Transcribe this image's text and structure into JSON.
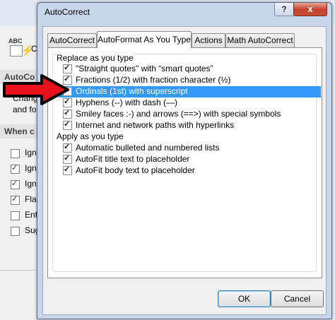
{
  "background_dialog": {
    "icon_text": "ABC",
    "section1_title": "AutoCo",
    "section1_text": [
      "Chang",
      "and fo"
    ],
    "section2_title": "When c",
    "checks": [
      {
        "label": "Ign",
        "checked": false
      },
      {
        "label": "Ign",
        "checked": true
      },
      {
        "label": "Ign",
        "checked": true
      },
      {
        "label": "Fla",
        "checked": true
      },
      {
        "label": "Enf",
        "checked": false
      },
      {
        "label": "Sug",
        "checked": false
      }
    ],
    "window_letter": "C"
  },
  "dialog": {
    "title": "AutoCorrect",
    "help_label": "?",
    "close_label": "x",
    "tabs": [
      {
        "label": "AutoCorrect",
        "active": false
      },
      {
        "label": "AutoFormat As You Type",
        "active": true
      },
      {
        "label": "Actions",
        "active": false
      },
      {
        "label": "Math AutoCorrect",
        "active": false
      }
    ],
    "replace_group": {
      "label": "Replace as you type",
      "items": [
        {
          "label": "\"Straight quotes\" with “smart quotes”",
          "checked": true,
          "selected": false
        },
        {
          "label": "Fractions (1/2) with fraction character (½)",
          "checked": true,
          "selected": false
        },
        {
          "label": "Ordinals (1st) with superscript",
          "checked": false,
          "selected": true
        },
        {
          "label": "Hyphens (--) with dash (—)",
          "checked": true,
          "selected": false
        },
        {
          "label": "Smiley faces :-) and arrows (==>) with special symbols",
          "checked": true,
          "selected": false
        },
        {
          "label": "Internet and network paths with hyperlinks",
          "checked": true,
          "selected": false
        }
      ]
    },
    "apply_group": {
      "label": "Apply as you type",
      "items": [
        {
          "label": "Automatic bulleted and numbered lists",
          "checked": true
        },
        {
          "label": "AutoFit title text to placeholder",
          "checked": true
        },
        {
          "label": "AutoFit body text to placeholder",
          "checked": true
        }
      ]
    },
    "ok_label": "OK",
    "cancel_label": "Cancel"
  },
  "colors": {
    "selection": "#3399ff",
    "arrow_fill": "#e8111a",
    "arrow_stroke": "#000000",
    "window_frame": "#c7d6ea",
    "close_button": "#c7402c"
  },
  "arrow_icon": "red-arrow-pointer"
}
